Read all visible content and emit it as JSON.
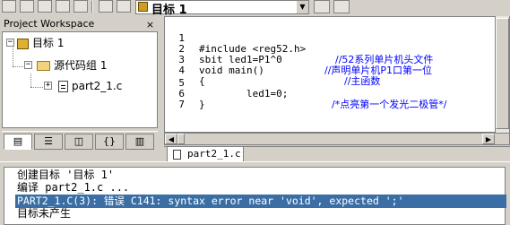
{
  "toolbar": {
    "target_name": "目标 1",
    "dropdown_glyph": "▼"
  },
  "workspace": {
    "title": "Project Workspace",
    "close_glyph": "×",
    "tree": [
      {
        "expander": "−",
        "label": "目标 1"
      },
      {
        "expander": "−",
        "label": "源代码组 1"
      },
      {
        "expander": "+",
        "label": "part2_1.c"
      }
    ],
    "tabs": [
      "files",
      "regs",
      "books",
      "functions",
      "templates"
    ]
  },
  "editor": {
    "lines": [
      {
        "num": "1",
        "code": "#include <reg52.h>",
        "comment": "//52系列单片机头文件"
      },
      {
        "num": "2",
        "code": "sbit led1=P1^0",
        "comment": "//声明单片机P1口第一位"
      },
      {
        "num": "3",
        "code": "void main()",
        "comment": "//主函数"
      },
      {
        "num": "4",
        "code": "{",
        "comment": ""
      },
      {
        "num": "5",
        "code": "        led1=0;",
        "comment": "/*点亮第一个发光二极管*/"
      },
      {
        "num": "6",
        "code": "}",
        "comment": ""
      },
      {
        "num": "7",
        "code": "",
        "comment": ""
      }
    ],
    "file_tab": "part2_1.c"
  },
  "output": {
    "lines": [
      "创建目标 '目标 1'",
      "编译 part2_1.c ...",
      "PART2_1.C(3): 错误 C141: syntax error near 'void', expected ';'",
      "目标未产生"
    ],
    "highlighted_index": 2
  },
  "colors": {
    "chrome": "#d4d0c8",
    "comment": "#0000ff",
    "selection": "#3a6ea5"
  }
}
